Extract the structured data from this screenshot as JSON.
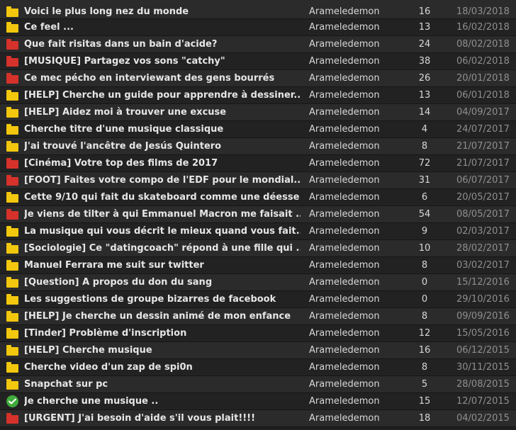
{
  "topics": [
    {
      "icon": "folder-yellow-icon",
      "title": "Voici le plus long nez du monde",
      "author": "Arameledemon",
      "count": "16",
      "date": "18/03/2018"
    },
    {
      "icon": "folder-yellow-icon",
      "title": "Ce feel ...",
      "author": "Arameledemon",
      "count": "13",
      "date": "16/02/2018"
    },
    {
      "icon": "folder-red-icon",
      "title": "Que fait risitas dans un bain d'acide?",
      "author": "Arameledemon",
      "count": "24",
      "date": "08/02/2018"
    },
    {
      "icon": "folder-red-icon",
      "title": "[MUSIQUE] Partagez vos sons \"catchy\"",
      "author": "Arameledemon",
      "count": "38",
      "date": "06/02/2018"
    },
    {
      "icon": "folder-red-icon",
      "title": "Ce mec pécho en interviewant des gens bourrés",
      "author": "Arameledemon",
      "count": "26",
      "date": "20/01/2018"
    },
    {
      "icon": "folder-yellow-icon",
      "title": "[HELP] Cherche un guide pour apprendre à dessiner...",
      "author": "Arameledemon",
      "count": "13",
      "date": "06/01/2018"
    },
    {
      "icon": "folder-yellow-icon",
      "title": "[HELP] Aidez moi à trouver une excuse",
      "author": "Arameledemon",
      "count": "14",
      "date": "04/09/2017"
    },
    {
      "icon": "folder-yellow-icon",
      "title": "Cherche titre d'une musique classique",
      "author": "Arameledemon",
      "count": "4",
      "date": "24/07/2017"
    },
    {
      "icon": "folder-yellow-icon",
      "title": "J'ai trouvé l'ancêtre de Jesús Quintero",
      "author": "Arameledemon",
      "count": "8",
      "date": "21/07/2017"
    },
    {
      "icon": "folder-red-icon",
      "title": "[Cinéma] Votre top des films de 2017",
      "author": "Arameledemon",
      "count": "72",
      "date": "21/07/2017"
    },
    {
      "icon": "folder-red-icon",
      "title": "[FOOT] Faites votre compo de l'EDF pour le mondial...",
      "author": "Arameledemon",
      "count": "31",
      "date": "06/07/2017"
    },
    {
      "icon": "folder-yellow-icon",
      "title": "Cette 9/10 qui fait du skateboard comme une déesse",
      "author": "Arameledemon",
      "count": "6",
      "date": "20/05/2017"
    },
    {
      "icon": "folder-red-icon",
      "title": "Je viens de tilter à qui Emmanuel Macron me faisait ...",
      "author": "Arameledemon",
      "count": "54",
      "date": "08/05/2017"
    },
    {
      "icon": "folder-yellow-icon",
      "title": "La musique qui vous décrit le mieux quand vous fait...",
      "author": "Arameledemon",
      "count": "9",
      "date": "02/03/2017"
    },
    {
      "icon": "folder-yellow-icon",
      "title": "[Sociologie] Ce \"datingcoach\" répond à une fille qui ...",
      "author": "Arameledemon",
      "count": "10",
      "date": "28/02/2017"
    },
    {
      "icon": "folder-yellow-icon",
      "title": "Manuel Ferrara me suit sur twitter",
      "author": "Arameledemon",
      "count": "8",
      "date": "03/02/2017"
    },
    {
      "icon": "folder-yellow-icon",
      "title": "[Question] A propos du don du sang",
      "author": "Arameledemon",
      "count": "0",
      "date": "15/12/2016"
    },
    {
      "icon": "folder-yellow-icon",
      "title": "Les suggestions de groupe bizarres de facebook",
      "author": "Arameledemon",
      "count": "0",
      "date": "29/10/2016"
    },
    {
      "icon": "folder-yellow-icon",
      "title": "[HELP] Je cherche un dessin animé de mon enfance",
      "author": "Arameledemon",
      "count": "8",
      "date": "09/09/2016"
    },
    {
      "icon": "folder-yellow-icon",
      "title": "[Tinder] Problème d'inscription",
      "author": "Arameledemon",
      "count": "12",
      "date": "15/05/2016"
    },
    {
      "icon": "folder-yellow-icon",
      "title": "[HELP] Cherche musique",
      "author": "Arameledemon",
      "count": "16",
      "date": "06/12/2015"
    },
    {
      "icon": "folder-yellow-icon",
      "title": "Cherche video d'un zap de spi0n",
      "author": "Arameledemon",
      "count": "8",
      "date": "30/11/2015"
    },
    {
      "icon": "folder-yellow-icon",
      "title": "Snapchat sur pc",
      "author": "Arameledemon",
      "count": "5",
      "date": "28/08/2015"
    },
    {
      "icon": "check-resolved-icon",
      "title": "Je cherche une musique ..",
      "author": "Arameledemon",
      "count": "15",
      "date": "12/07/2015"
    },
    {
      "icon": "folder-red-icon",
      "title": "[URGENT] J'ai besoin d'aide s'il vous plait!!!!",
      "author": "Arameledemon",
      "count": "18",
      "date": "04/02/2015"
    }
  ],
  "colors": {
    "folder_yellow": "#f2c70e",
    "folder_red": "#d6322b",
    "check_green": "#3faa3a",
    "title_text": "#e6e6e6",
    "date_text": "#8f8f8f"
  }
}
